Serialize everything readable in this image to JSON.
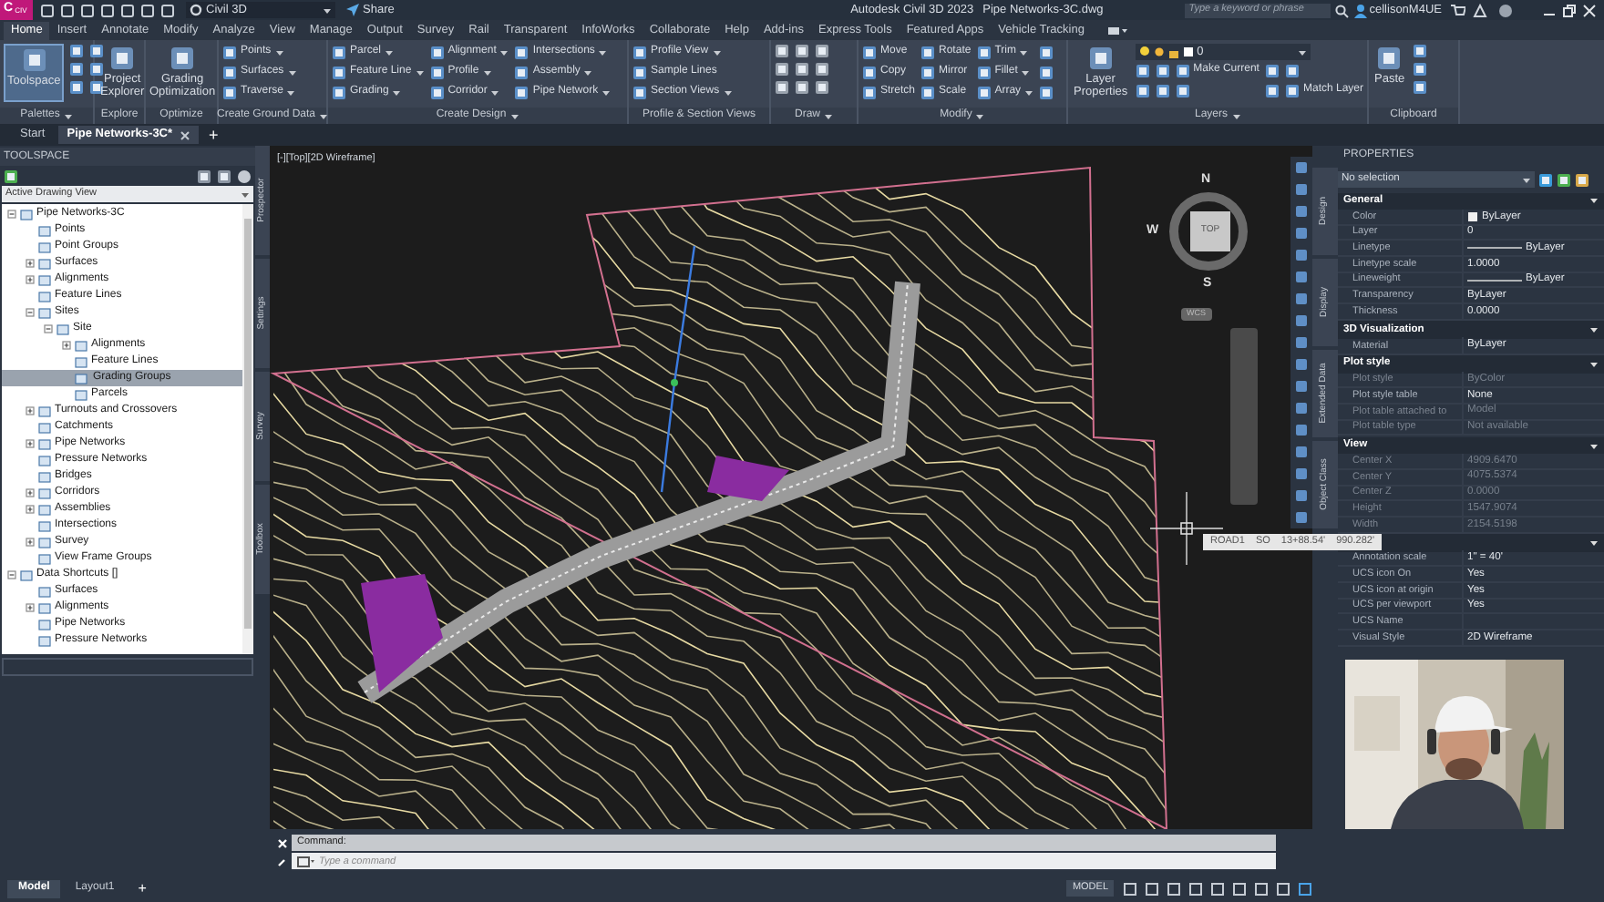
{
  "title_bar": {
    "logo": "C",
    "logo_badge": "CIV",
    "workspace": "Civil 3D",
    "share": "Share",
    "app_title": "Autodesk Civil 3D 2023",
    "file_name": "Pipe Networks-3C.dwg",
    "search": {
      "placeholder": "Type a keyword or phrase"
    },
    "user": "cellisonM4UE"
  },
  "ribbon_tabs": [
    {
      "label": "Home",
      "selected": true
    },
    {
      "label": "Insert",
      "selected": false
    },
    {
      "label": "Annotate",
      "selected": false
    },
    {
      "label": "Modify",
      "selected": false
    },
    {
      "label": "Analyze",
      "selected": false
    },
    {
      "label": "View",
      "selected": false
    },
    {
      "label": "Manage",
      "selected": false
    },
    {
      "label": "Output",
      "selected": false
    },
    {
      "label": "Survey",
      "selected": false
    },
    {
      "label": "Rail",
      "selected": false
    },
    {
      "label": "Transparent",
      "selected": false
    },
    {
      "label": "InfoWorks",
      "selected": false
    },
    {
      "label": "Collaborate",
      "selected": false
    },
    {
      "label": "Help",
      "selected": false
    },
    {
      "label": "Add-ins",
      "selected": false
    },
    {
      "label": "Express Tools",
      "selected": false
    },
    {
      "label": "Featured Apps",
      "selected": false
    },
    {
      "label": "Vehicle Tracking",
      "selected": false
    }
  ],
  "ribbon_panels": [
    {
      "title": "Palettes",
      "menu": true,
      "large": [
        {
          "label": "Toolspace",
          "selected": true
        }
      ],
      "small": [
        {
          "kind": "icon"
        },
        {
          "kind": "icon"
        },
        {
          "kind": "icon"
        },
        {
          "kind": "icon"
        },
        {
          "kind": "icon"
        },
        {
          "kind": "icon"
        }
      ]
    },
    {
      "title": "Explore",
      "menu": false,
      "large": [
        {
          "label": "Project Explorer",
          "selected": false
        }
      ]
    },
    {
      "title": "Optimize",
      "menu": false,
      "large": [
        {
          "label": "Grading Optimization",
          "selected": false
        }
      ]
    },
    {
      "title": "Create Ground Data",
      "menu": true,
      "small": [
        {
          "kind": "tool",
          "label": "Points",
          "menu": true
        },
        {
          "kind": "tool",
          "label": "Surfaces",
          "menu": true
        },
        {
          "kind": "tool",
          "label": "Traverse",
          "menu": true
        }
      ]
    },
    {
      "title": "Create Design",
      "menu": true,
      "small": [
        {
          "kind": "tool",
          "label": "Parcel",
          "menu": true
        },
        {
          "kind": "tool",
          "label": "Feature Line",
          "menu": true
        },
        {
          "kind": "tool",
          "label": "Grading",
          "menu": true
        },
        {
          "kind": "tool",
          "label": "Alignment",
          "menu": true
        },
        {
          "kind": "tool",
          "label": "Profile",
          "menu": true
        },
        {
          "kind": "tool",
          "label": "Corridor",
          "menu": true
        },
        {
          "kind": "tool",
          "label": "Intersections",
          "menu": true
        },
        {
          "kind": "tool",
          "label": "Assembly",
          "menu": true
        },
        {
          "kind": "tool",
          "label": "Pipe Network",
          "menu": true
        }
      ]
    },
    {
      "title": "Profile & Section Views",
      "menu": false,
      "small": [
        {
          "kind": "tool",
          "label": "Profile View",
          "menu": true
        },
        {
          "kind": "tool",
          "label": "Sample Lines",
          "menu": false
        },
        {
          "kind": "tool",
          "label": "Section Views",
          "menu": true
        }
      ]
    },
    {
      "title": "Draw",
      "menu": true,
      "small": [
        {
          "kind": "icon"
        },
        {
          "kind": "icon"
        },
        {
          "kind": "icon"
        },
        {
          "kind": "icon"
        },
        {
          "kind": "icon"
        },
        {
          "kind": "icon"
        },
        {
          "kind": "icon"
        },
        {
          "kind": "icon"
        },
        {
          "kind": "icon"
        }
      ]
    },
    {
      "title": "Modify",
      "menu": true,
      "small": [
        {
          "kind": "tool",
          "label": "Move",
          "menu": false
        },
        {
          "kind": "tool",
          "label": "Copy",
          "menu": false
        },
        {
          "kind": "tool",
          "label": "Stretch",
          "menu": false
        },
        {
          "kind": "tool",
          "label": "Rotate",
          "menu": false
        },
        {
          "kind": "tool",
          "label": "Mirror",
          "menu": false
        },
        {
          "kind": "tool",
          "label": "Scale",
          "menu": false
        },
        {
          "kind": "tool",
          "label": "Trim",
          "menu": true
        },
        {
          "kind": "tool",
          "label": "Fillet",
          "menu": true
        },
        {
          "kind": "tool",
          "label": "Array",
          "menu": true
        },
        {
          "kind": "icon"
        },
        {
          "kind": "icon"
        },
        {
          "kind": "icon"
        }
      ]
    },
    {
      "title": "Layers",
      "menu": true,
      "large": [
        {
          "label": "Layer Properties",
          "selected": false
        }
      ],
      "dropdown": {
        "value": "0"
      },
      "small": [
        {
          "kind": "icon"
        },
        {
          "kind": "icon"
        },
        {
          "kind": "icon"
        },
        {
          "kind": "icon"
        },
        {
          "kind": "tool",
          "label": "Make Current",
          "menu": false
        },
        {
          "kind": "icon"
        },
        {
          "kind": "icon"
        },
        {
          "kind": "icon"
        },
        {
          "kind": "icon"
        },
        {
          "kind": "tool",
          "label": "Match Layer",
          "menu": false
        }
      ]
    },
    {
      "title": "Clipboard",
      "menu": false,
      "large": [
        {
          "label": "Paste",
          "selected": false
        }
      ],
      "small": [
        {
          "kind": "icon"
        },
        {
          "kind": "icon"
        },
        {
          "kind": "icon"
        }
      ]
    }
  ],
  "doc_tabs": [
    {
      "label": "Start",
      "selected": false,
      "closable": false
    },
    {
      "label": "Pipe Networks-3C*",
      "selected": true,
      "closable": true
    }
  ],
  "new_tab": "+",
  "toolspace": {
    "title": "TOOLSPACE",
    "view": "Active Drawing View",
    "side_tabs": [
      "Prospector",
      "Settings",
      "Survey",
      "Toolbox"
    ],
    "tree": [
      {
        "label": "Pipe Networks-3C",
        "expanded": true,
        "selected": false,
        "children": [
          {
            "label": "Points",
            "selected": false
          },
          {
            "label": "Point Groups",
            "selected": false
          },
          {
            "label": "Surfaces",
            "expanded": false,
            "selected": false
          },
          {
            "label": "Alignments",
            "expanded": false,
            "selected": false
          },
          {
            "label": "Feature Lines",
            "selected": false
          },
          {
            "label": "Sites",
            "expanded": true,
            "selected": false,
            "children": [
              {
                "label": "Site",
                "expanded": true,
                "selected": false,
                "children": [
                  {
                    "label": "Alignments",
                    "expanded": false,
                    "selected": false
                  },
                  {
                    "label": "Feature Lines",
                    "selected": false
                  },
                  {
                    "label": "Grading Groups",
                    "selected": true
                  },
                  {
                    "label": "Parcels",
                    "selected": false
                  }
                ]
              }
            ]
          },
          {
            "label": "Turnouts and Crossovers",
            "expanded": false,
            "selected": false
          },
          {
            "label": "Catchments",
            "selected": false
          },
          {
            "label": "Pipe Networks",
            "expanded": false,
            "selected": false
          },
          {
            "label": "Pressure Networks",
            "selected": false
          },
          {
            "label": "Bridges",
            "selected": false
          },
          {
            "label": "Corridors",
            "expanded": false,
            "selected": false
          },
          {
            "label": "Assemblies",
            "expanded": false,
            "selected": false
          },
          {
            "label": "Intersections",
            "selected": false
          },
          {
            "label": "Survey",
            "expanded": false,
            "selected": false
          },
          {
            "label": "View Frame Groups",
            "selected": false
          }
        ]
      },
      {
        "label": "Data Shortcuts []",
        "expanded": true,
        "selected": false,
        "children": [
          {
            "label": "Surfaces",
            "selected": false
          },
          {
            "label": "Alignments",
            "expanded": false,
            "selected": false
          },
          {
            "label": "Pipe Networks",
            "selected": false
          },
          {
            "label": "Pressure Networks",
            "selected": false
          }
        ]
      }
    ]
  },
  "viewport": {
    "label": "[-][Top][2D Wireframe]",
    "viewcube": {
      "face": "TOP",
      "north": "N",
      "west": "W",
      "south": "S",
      "ucs": "WCS"
    },
    "tooltip": [
      "ROAD1",
      "SO",
      "13+88.54'",
      "990.282'"
    ]
  },
  "properties": {
    "title": "PROPERTIES",
    "selection": "No selection",
    "side_tabs": [
      "Design",
      "Display",
      "Extended Data",
      "Object Class"
    ],
    "sections": [
      {
        "title": "General",
        "rows": [
          {
            "name": "Color",
            "value": "ByLayer",
            "kind": "swatch",
            "disabled": false
          },
          {
            "name": "Layer",
            "value": "0",
            "kind": "text",
            "disabled": false
          },
          {
            "name": "Linetype",
            "value": "ByLayer",
            "kind": "line",
            "disabled": false
          },
          {
            "name": "Linetype scale",
            "value": "1.0000",
            "kind": "text",
            "disabled": false
          },
          {
            "name": "Lineweight",
            "value": "ByLayer",
            "kind": "line",
            "disabled": false
          },
          {
            "name": "Transparency",
            "value": "ByLayer",
            "kind": "text",
            "disabled": false
          },
          {
            "name": "Thickness",
            "value": "0.0000",
            "kind": "text",
            "disabled": false
          }
        ]
      },
      {
        "title": "3D Visualization",
        "rows": [
          {
            "name": "Material",
            "value": "ByLayer",
            "kind": "text",
            "disabled": false
          }
        ]
      },
      {
        "title": "Plot style",
        "rows": [
          {
            "name": "Plot style",
            "value": "ByColor",
            "kind": "text",
            "disabled": true
          },
          {
            "name": "Plot style table",
            "value": "None",
            "kind": "text",
            "disabled": false
          },
          {
            "name": "Plot table attached to",
            "value": "Model",
            "kind": "text",
            "disabled": true
          },
          {
            "name": "Plot table type",
            "value": "Not available",
            "kind": "text",
            "disabled": true
          }
        ]
      },
      {
        "title": "View",
        "rows": [
          {
            "name": "Center X",
            "value": "4909.6470",
            "kind": "text",
            "disabled": true
          },
          {
            "name": "Center Y",
            "value": "4075.5374",
            "kind": "text",
            "disabled": true
          },
          {
            "name": "Center Z",
            "value": "0.0000",
            "kind": "text",
            "disabled": true
          },
          {
            "name": "Height",
            "value": "1547.9074",
            "kind": "text",
            "disabled": true
          },
          {
            "name": "Width",
            "value": "2154.5198",
            "kind": "text",
            "disabled": true
          }
        ]
      },
      {
        "rows": [
          {
            "name": "Annotation scale",
            "value": "1\" = 40'",
            "kind": "text",
            "disabled": false
          },
          {
            "name": "UCS icon On",
            "value": "Yes",
            "kind": "text",
            "disabled": false
          },
          {
            "name": "UCS icon at origin",
            "value": "Yes",
            "kind": "text",
            "disabled": false
          },
          {
            "name": "UCS per viewport",
            "value": "Yes",
            "kind": "text",
            "disabled": false
          },
          {
            "name": "UCS Name",
            "kind": "text",
            "disabled": false
          },
          {
            "name": "Visual Style",
            "value": "2D Wireframe",
            "kind": "text",
            "disabled": false
          }
        ]
      }
    ]
  },
  "command_line": {
    "label": "Command:",
    "placeholder": "Type a command"
  },
  "status_bar": {
    "layout_tabs": [
      {
        "label": "Model",
        "selected": true
      },
      {
        "label": "Layout1",
        "selected": false
      }
    ],
    "add": "+",
    "space": "MODEL"
  }
}
